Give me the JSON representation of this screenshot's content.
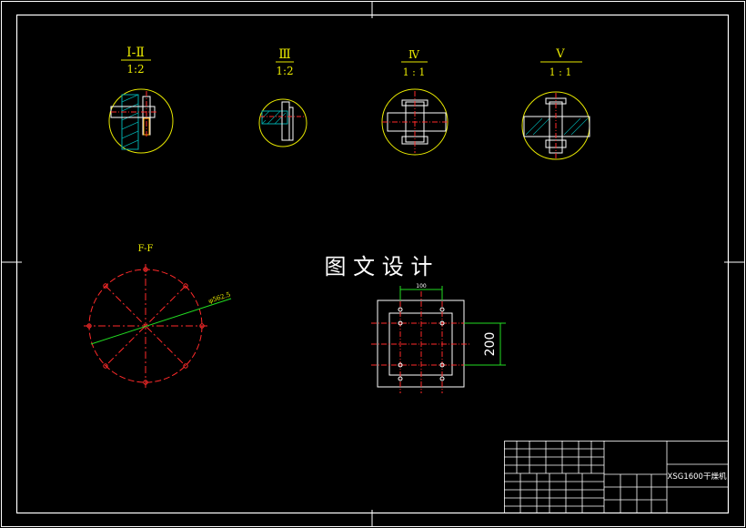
{
  "canvas": {
    "background": "#000000"
  },
  "colors": {
    "frame": "#ffffff",
    "label": "#e8e800",
    "center_line": "#ff2a2a",
    "cyan": "#00d8d8",
    "green": "#22dd22",
    "hatch": "#00aaaa"
  },
  "details": [
    {
      "roman": "Ⅰ-Ⅱ",
      "scale": "1:2"
    },
    {
      "roman": "Ⅲ",
      "scale": "1:2"
    },
    {
      "roman": "Ⅳ",
      "scale": "1 : 1"
    },
    {
      "roman": "Ⅴ",
      "scale": "1 : 1"
    }
  ],
  "flange_view": {
    "label": "F-F",
    "dia_label": "φ562.5"
  },
  "watermark": "图 文 设 计",
  "square_view": {
    "dim_top": "100",
    "dim_side": "200"
  },
  "title_block": {
    "drawing_title": "XSG1600干燥机"
  }
}
